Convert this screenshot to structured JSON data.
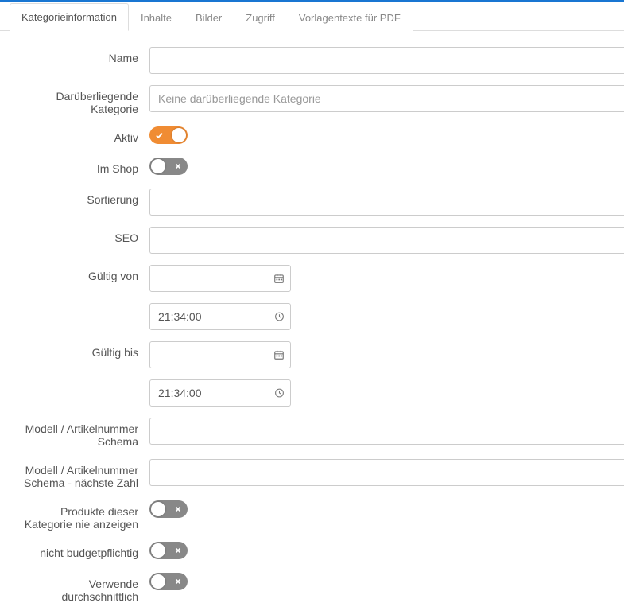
{
  "tabs": [
    {
      "label": "Kategorieinformation",
      "active": true
    },
    {
      "label": "Inhalte",
      "active": false
    },
    {
      "label": "Bilder",
      "active": false
    },
    {
      "label": "Zugriff",
      "active": false
    },
    {
      "label": "Vorlagentexte für PDF",
      "active": false
    }
  ],
  "form": {
    "name": {
      "label": "Name",
      "value": ""
    },
    "parent_category": {
      "label": "Darüberliegende Kategorie",
      "placeholder": "Keine darüberliegende Kategorie",
      "value": ""
    },
    "active": {
      "label": "Aktiv",
      "value": true
    },
    "in_shop": {
      "label": "Im Shop",
      "value": false
    },
    "sort": {
      "label": "Sortierung",
      "value": ""
    },
    "seo": {
      "label": "SEO",
      "value": ""
    },
    "valid_from": {
      "label": "Gültig von",
      "date": "",
      "time": "21:34:00"
    },
    "valid_to": {
      "label": "Gültig bis",
      "date": "",
      "time": "21:34:00"
    },
    "model_schema": {
      "label": "Modell / Artikelnummer Schema",
      "value": ""
    },
    "model_schema_next": {
      "label": "Modell / Artikelnummer Schema - nächste Zahl",
      "value": ""
    },
    "hide_products": {
      "label": "Produkte dieser Kategorie nie anzeigen",
      "value": false
    },
    "not_budget": {
      "label": "nicht budgetpflichtig",
      "value": false
    },
    "use_average": {
      "label": "Verwende durchschnittlich",
      "value": false
    }
  }
}
